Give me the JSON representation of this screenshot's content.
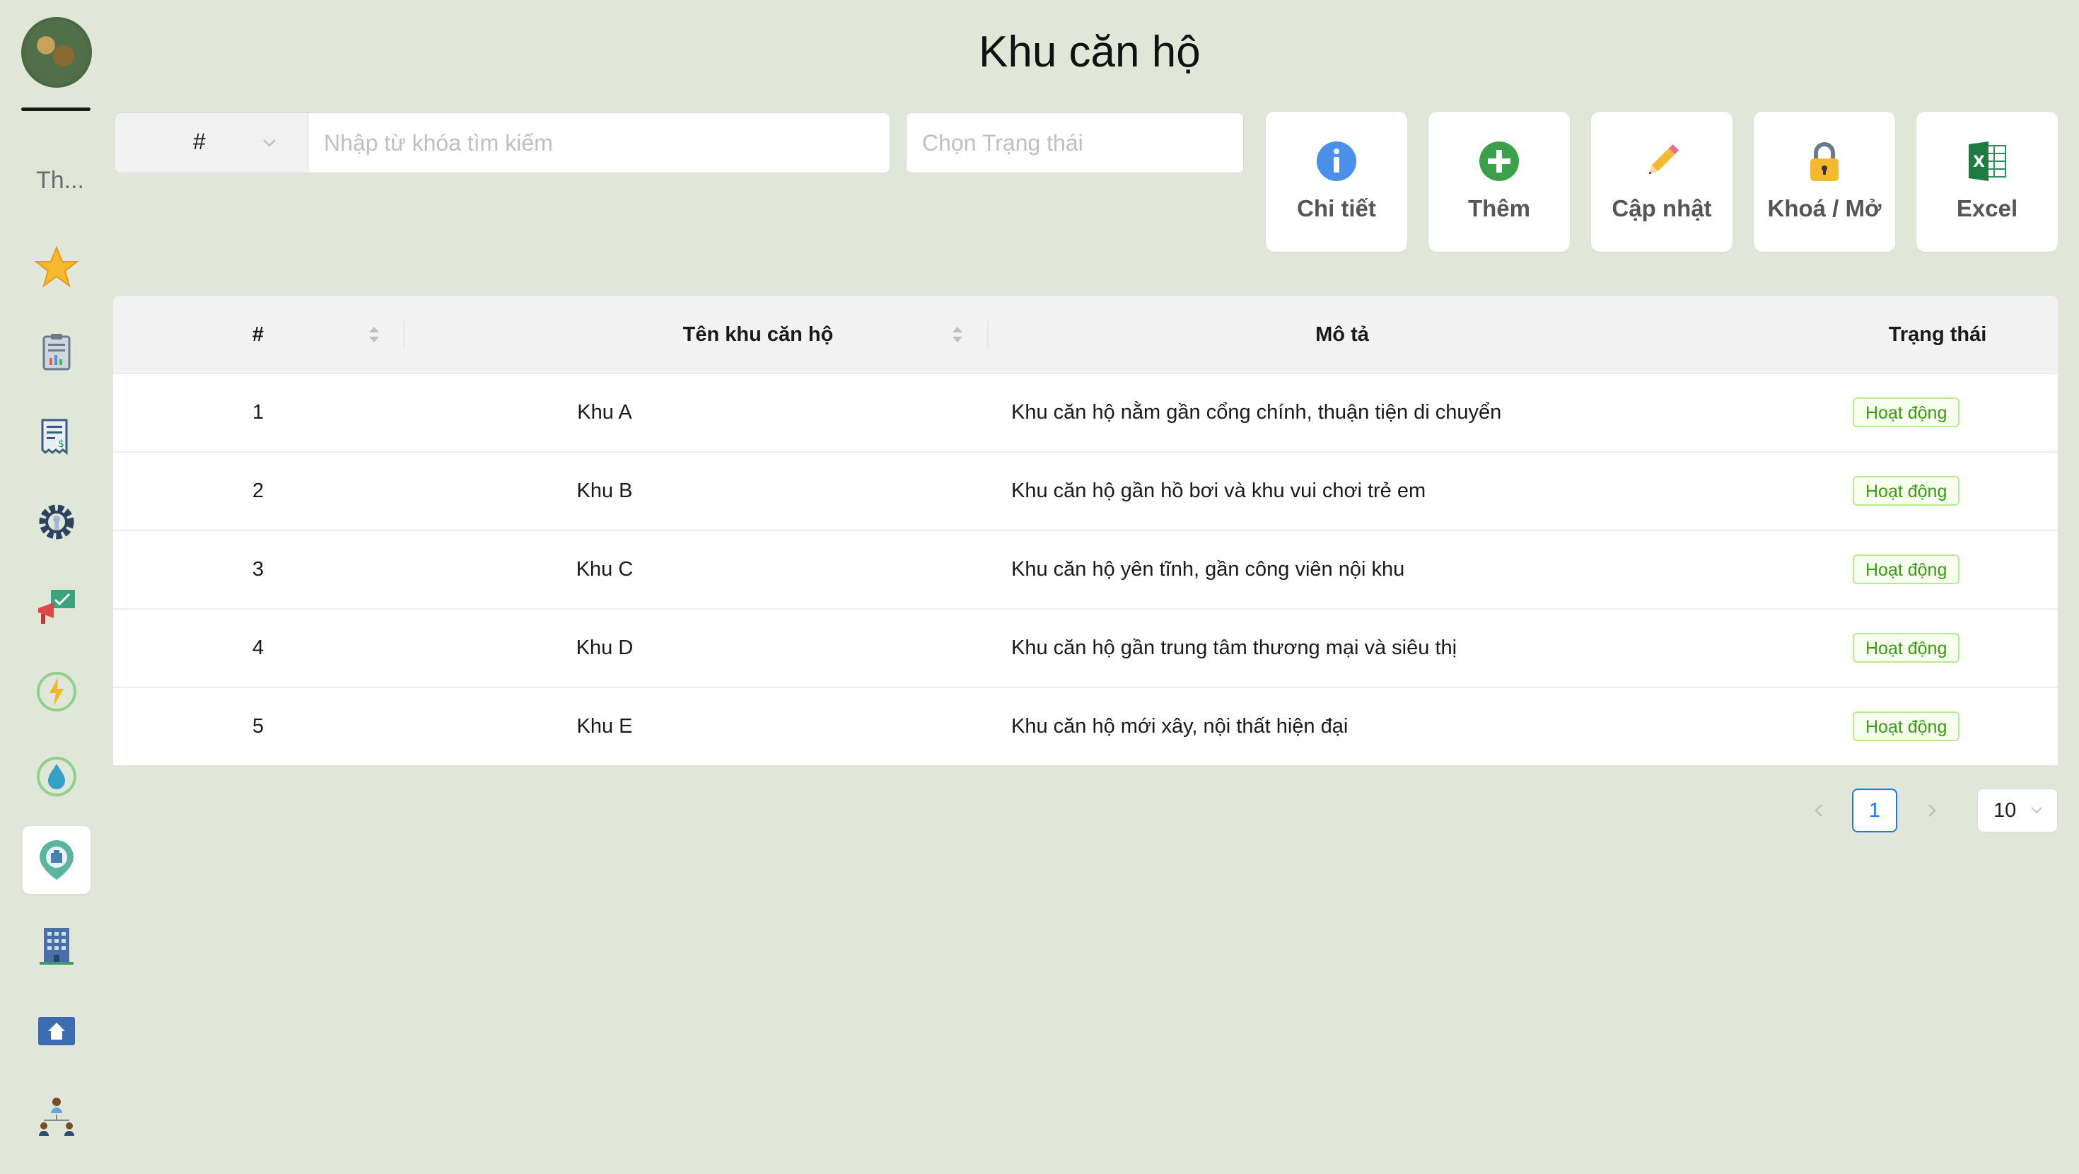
{
  "sidebar": {
    "title": "Th...",
    "icons": [
      "star-icon",
      "report-icon",
      "invoice-icon",
      "settings-gear-icon",
      "announcement-icon",
      "electricity-icon",
      "water-icon",
      "apartment-area-icon",
      "building-icon",
      "house-icon",
      "people-icon"
    ],
    "active": "apartment-area-icon"
  },
  "page": {
    "title": "Khu căn hộ"
  },
  "search": {
    "field_value": "#",
    "placeholder": "Nhập từ khóa tìm kiếm",
    "status_placeholder": "Chọn Trạng thái"
  },
  "actions": [
    {
      "label": "Chi tiết",
      "icon": "info-icon"
    },
    {
      "label": "Thêm",
      "icon": "add-icon"
    },
    {
      "label": "Cập nhật",
      "icon": "pencil-icon"
    },
    {
      "label": "Khoá / Mở",
      "icon": "lock-icon"
    },
    {
      "label": "Excel",
      "icon": "excel-icon"
    }
  ],
  "table": {
    "columns": [
      "#",
      "Tên khu căn hộ",
      "Mô tả",
      "Trạng thái"
    ],
    "rows": [
      {
        "no": "1",
        "name": "Khu A",
        "desc": "Khu căn hộ nằm gần cổng chính, thuận tiện di chuyển",
        "status": "Hoạt động"
      },
      {
        "no": "2",
        "name": "Khu B",
        "desc": "Khu căn hộ gần hồ bơi và khu vui chơi trẻ em",
        "status": "Hoạt động"
      },
      {
        "no": "3",
        "name": "Khu C",
        "desc": "Khu căn hộ yên tĩnh, gần công viên nội khu",
        "status": "Hoạt động"
      },
      {
        "no": "4",
        "name": "Khu D",
        "desc": "Khu căn hộ gần trung tâm thương mại và siêu thị",
        "status": "Hoạt động"
      },
      {
        "no": "5",
        "name": "Khu E",
        "desc": "Khu căn hộ mới xây, nội thất hiện đại",
        "status": "Hoạt động"
      }
    ]
  },
  "pagination": {
    "current": "1",
    "page_size": "10"
  },
  "colors": {
    "background": "#e0e7d8",
    "primary": "#1677ff",
    "status_green": "#389e0d"
  }
}
